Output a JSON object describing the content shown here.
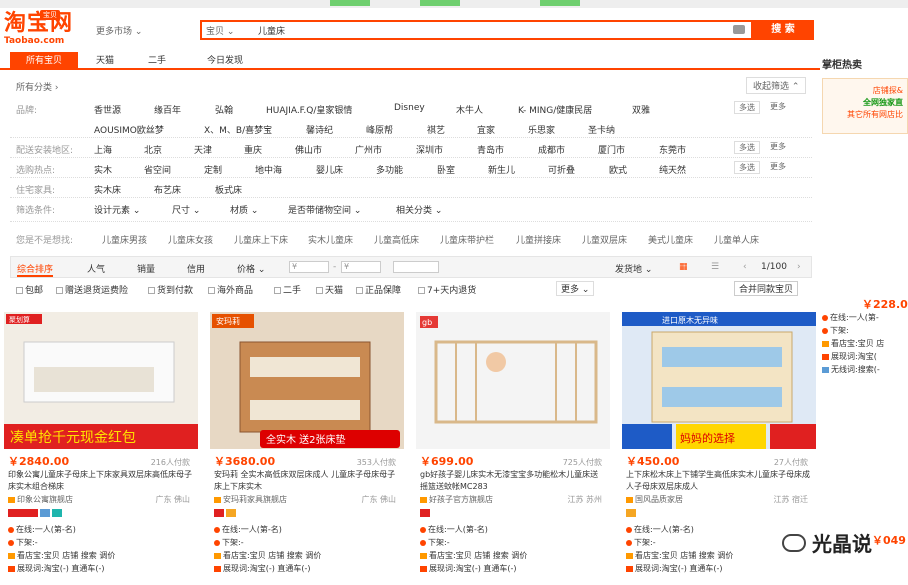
{
  "header": {
    "logo_cn": "淘宝网",
    "logo_en": "Taobao.com",
    "logo_tag": "宝贝",
    "market": "更多市场",
    "search_category": "宝贝",
    "search_query": "儿童床",
    "search_button": "搜 索"
  },
  "tabs": [
    "所有宝贝",
    "天猫",
    "二手",
    "今日发现"
  ],
  "right": {
    "title": "掌柜热卖",
    "ad_line1": "店铺探&",
    "ad_line2": "全网独家直",
    "ad_line3": "其它所有网店比",
    "price": "￥228.0",
    "online": "在线:一人(第-",
    "offline": "下架:",
    "shop": "看店宝:宝贝 店",
    "show": "展现词:淘宝(",
    "nosearch": "无线词:搜索(-",
    "price2": "￥049"
  },
  "filters": {
    "all_categories": "所有分类",
    "collapse": "收起筛选",
    "brand_label": "品牌:",
    "brands_row1": [
      "香世源",
      "缘百年",
      "弘翰",
      "HUAJIA.F.Q/皇家银情",
      "Disney",
      "木牛人",
      "K- MING/健康民居",
      "双雅"
    ],
    "brands_row2": [
      "AOUSIMO欧丝梦",
      "X、M、B/喜梦宝",
      "馨诗纪",
      "峰原帮",
      "祺艺",
      "宜家",
      "乐思家",
      "圣卡纳"
    ],
    "multi": "多选",
    "more": "更多",
    "region_label": "配送安装地区:",
    "regions": [
      "上海",
      "北京",
      "天津",
      "重庆",
      "佛山市",
      "广州市",
      "深圳市",
      "青岛市",
      "成都市",
      "厦门市",
      "东莞市"
    ],
    "hot_label": "选购热点:",
    "hot": [
      "实木",
      "省空间",
      "定制",
      "地中海",
      "婴儿床",
      "多功能",
      "卧室",
      "新生儿",
      "可折叠",
      "欧式",
      "纯天然"
    ],
    "home_label": "住宅家具:",
    "home": [
      "实木床",
      "布艺床",
      "板式床"
    ],
    "cond_label": "筛选条件:",
    "cond": [
      "设计元素",
      "尺寸",
      "材质",
      "是否带储物空间",
      "相关分类"
    ]
  },
  "suggest": {
    "label": "您是不是想找:",
    "items": [
      "儿童床男孩",
      "儿童床女孩",
      "儿童床上下床",
      "实木儿童床",
      "儿童高低床",
      "儿童床带护栏",
      "儿童拼接床",
      "儿童双层床",
      "美式儿童床",
      "儿童单人床"
    ]
  },
  "sort": {
    "items": [
      "综合排序",
      "人气",
      "销量",
      "信用",
      "价格"
    ],
    "price_from": "¥",
    "price_to": "¥",
    "ship": "发货地",
    "page": "1/100"
  },
  "options": [
    "包邮",
    "赠送退货运费险",
    "货到付款",
    "海外商品",
    "二手",
    "天猫",
    "正品保障",
    "7+天内退货"
  ],
  "options_more": "更多",
  "merge": "合并同款宝贝",
  "products": [
    {
      "price": "￥2840.00",
      "sold": "216人付款",
      "title": "印象公寓儿童床子母床上下床家具双层床高低床母子床实木组合梯床",
      "shop": "印象公寓旗舰店",
      "loc": "广东 佛山",
      "banner": "凑单抢千元现金红包",
      "brand": "聚划算",
      "color": "#e02020"
    },
    {
      "price": "￥3680.00",
      "sold": "353人付款",
      "title": "安玛莉 全实木高低床双层床成人 儿童床子母床母子床上下床实木",
      "shop": "安玛莉家具旗舰店",
      "loc": "广东 佛山",
      "banner": "全实木 送2张床垫",
      "brand": "安玛莉",
      "color": "#e65100"
    },
    {
      "price": "￥699.00",
      "sold": "725人付款",
      "title": "gb好孩子婴儿床实木无漆宝宝多功能松木儿童床送摇篮送蚊帐MC283",
      "shop": "好孩子官方旗舰店",
      "loc": "江苏 苏州",
      "banner": "",
      "brand": "gb",
      "color": "#c0c0c0"
    },
    {
      "price": "￥450.00",
      "sold": "27人付款",
      "title": "上下床松木床上下铺学生高低床实木儿童床子母床成人子母床双层床成人",
      "shop": "国风品质家居",
      "loc": "江苏 宿迁",
      "banner": "妈妈的选择",
      "brand": "进口原木无异味",
      "color": "#1e5bc6"
    }
  ],
  "product_lines": {
    "online": "在线:一人(第-名)",
    "offline": "下架:-",
    "shop": "看店宝:宝贝 店铺 搜索 调价",
    "show": "展现词:淘宝(-) 直通车(-)"
  },
  "watermark": "光晶说"
}
